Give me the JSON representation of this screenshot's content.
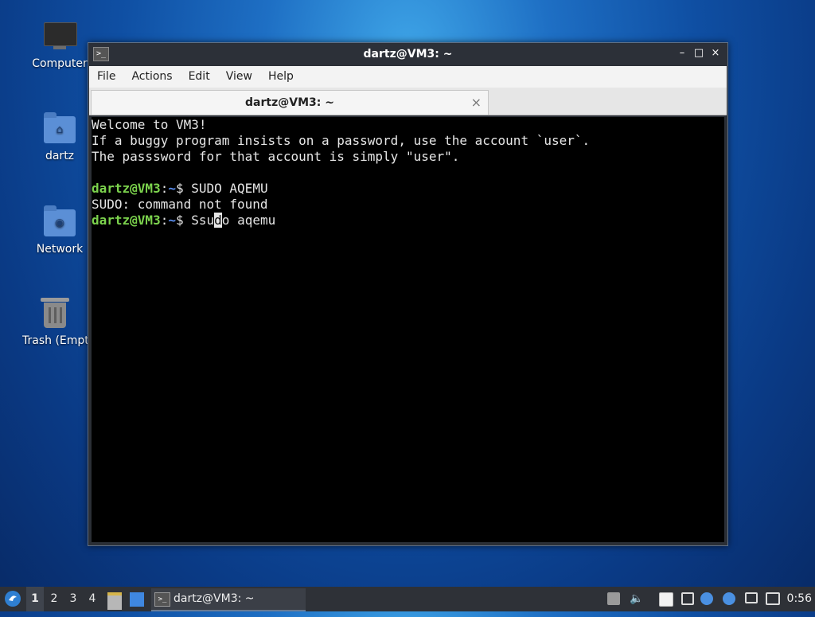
{
  "desktop": {
    "icons": [
      {
        "label": "Computer"
      },
      {
        "label": "dartz"
      },
      {
        "label": "Network"
      },
      {
        "label": "Trash (Empty)"
      }
    ]
  },
  "window": {
    "title": "dartz@VM3: ~",
    "menu": [
      "File",
      "Actions",
      "Edit",
      "View",
      "Help"
    ],
    "tab_label": "dartz@VM3: ~",
    "controls": {
      "minimize": "–",
      "maximize": "□",
      "close": "×"
    }
  },
  "terminal": {
    "welcome": [
      "Welcome to VM3!",
      "If a buggy program insists on a password, use the account `user`.",
      "The passsword for that account is simply \"user\"."
    ],
    "prompt_user": "dartz@VM3",
    "prompt_sep": ":",
    "prompt_path": "~",
    "prompt_end": "$ ",
    "cmd1": "SUDO AQEMU",
    "error": "SUDO: command not found",
    "cmd2_before": "Ssu",
    "cmd2_cursor": "d",
    "cmd2_after": "o aqemu"
  },
  "taskbar": {
    "workspaces": [
      "1",
      "2",
      "3",
      "4"
    ],
    "active_workspace": "1",
    "task_label": "dartz@VM3: ~",
    "clock": "0:56"
  }
}
